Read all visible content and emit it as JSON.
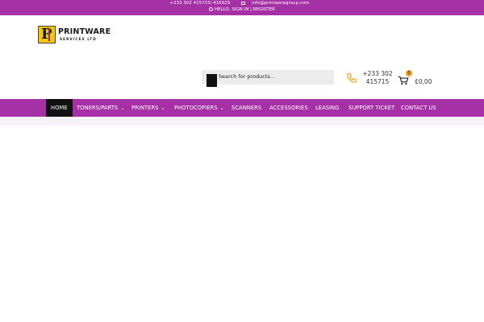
{
  "topbar": {
    "phone": "+233 302 415715/ 416929",
    "email": "info@printwaregroup.com",
    "account": "HELLO, SIGN IN | REGISTER"
  },
  "logo": {
    "letter": "P",
    "name": "PRINTWARE",
    "subtitle": "SERVICES LTD"
  },
  "search": {
    "placeholder": "Search for products..."
  },
  "contact": {
    "phone_line1": "+233 302",
    "phone_line2": "415715"
  },
  "cart": {
    "count": "0",
    "total": "₵0,00"
  },
  "nav": {
    "items": [
      {
        "label": "HOME",
        "active": true
      },
      {
        "label": "TONERS/PARTS",
        "dropdown": true
      },
      {
        "label": "PRINTERS",
        "dropdown": true
      },
      {
        "label": "PHOTOCOPIERS",
        "dropdown": true
      },
      {
        "label": "SCANNERS"
      },
      {
        "label": "ACCESSORIES"
      },
      {
        "label": "LEASING"
      },
      {
        "label": "SUPPORT TICKET"
      },
      {
        "label": "CONTACT US"
      }
    ]
  },
  "colors": {
    "brand_purple": "#a630a5",
    "active_nav": "#111111",
    "logo_yellow": "#f2c70b",
    "badge_orange": "#f29d1f"
  }
}
